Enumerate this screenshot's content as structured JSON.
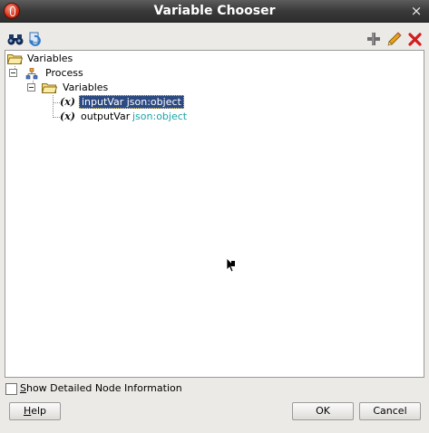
{
  "window": {
    "title": "Variable Chooser",
    "close_glyph": "×"
  },
  "toolbar": {
    "left_icons": [
      "binoculars-icon",
      "refresh-icon"
    ],
    "right_icons": [
      "add-icon",
      "edit-pencil-icon",
      "delete-icon"
    ]
  },
  "tree": {
    "root_label": "Variables",
    "process_label": "Process",
    "variables_label": "Variables",
    "items": [
      {
        "name": "inputVar",
        "type": "json:object",
        "selected": true
      },
      {
        "name": "outputVar",
        "type": "json:object",
        "selected": false
      }
    ]
  },
  "options": {
    "show_detail_prefix": "S",
    "show_detail_rest": "how Detailed Node Information",
    "show_detail_checked": false
  },
  "buttons": {
    "help_prefix": "",
    "help_mnemonic": "H",
    "help_rest": "elp",
    "ok_label": "OK",
    "cancel_label": "Cancel"
  },
  "colors": {
    "selection_bg": "#2b4a83",
    "type_text": "#1ba4a9",
    "titlebar": "#3a3a3a"
  }
}
